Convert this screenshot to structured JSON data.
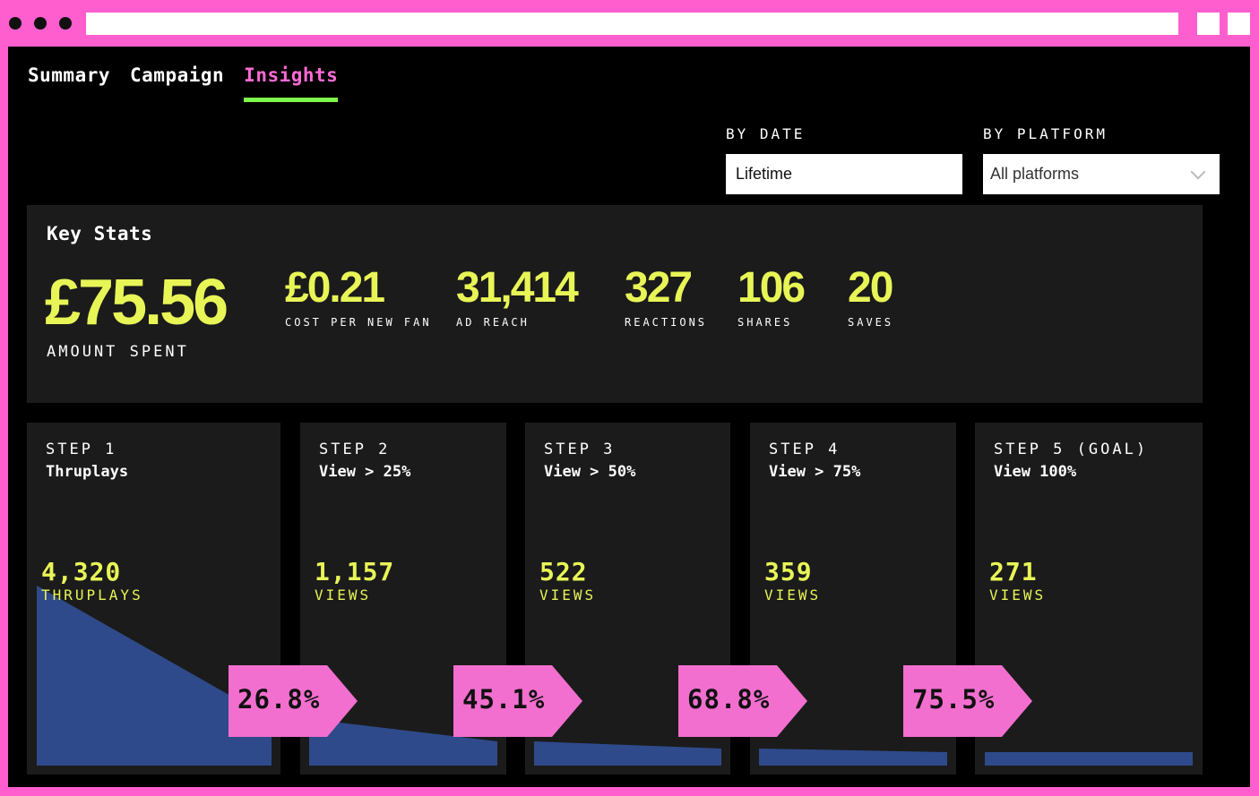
{
  "chrome": {
    "window_dots": 3
  },
  "tabs": [
    {
      "label": "Summary",
      "active": false
    },
    {
      "label": "Campaign",
      "active": false
    },
    {
      "label": "Insights",
      "active": true
    }
  ],
  "filters": {
    "date": {
      "label": "BY DATE",
      "value": "Lifetime"
    },
    "platform": {
      "label": "BY PLATFORM",
      "value": "All platforms"
    }
  },
  "key_stats": {
    "title": "Key Stats",
    "amount_spent": {
      "value": "£75.56",
      "label": "AMOUNT SPENT"
    },
    "stats": [
      {
        "value": "£0.21",
        "label": "COST PER NEW FAN"
      },
      {
        "value": "31,414",
        "label": "AD REACH"
      },
      {
        "value": "327",
        "label": "REACTIONS"
      },
      {
        "value": "106",
        "label": "SHARES"
      },
      {
        "value": "20",
        "label": "SAVES"
      }
    ]
  },
  "funnel": {
    "steps": [
      {
        "step": "STEP 1",
        "name": "Thruplays",
        "value": "4,320",
        "unit": "THRUPLAYS"
      },
      {
        "step": "STEP 2",
        "name": "View > 25%",
        "value": "1,157",
        "unit": "VIEWS"
      },
      {
        "step": "STEP 3",
        "name": "View > 50%",
        "value": "522",
        "unit": "VIEWS"
      },
      {
        "step": "STEP 4",
        "name": "View > 75%",
        "value": "359",
        "unit": "VIEWS"
      },
      {
        "step": "STEP 5 (GOAL)",
        "name": "View 100%",
        "value": "271",
        "unit": "VIEWS"
      }
    ],
    "conversion_rates": [
      "26.8%",
      "45.1%",
      "68.8%",
      "75.5%"
    ]
  },
  "colors": {
    "frame": "#ff5ecf",
    "accent_yellow": "#e8f556",
    "accent_pink": "#ff6ad5",
    "tab_underline": "#7bff4a",
    "funnel_fill": "#2f4a8a",
    "badge": "#f26fcf"
  }
}
